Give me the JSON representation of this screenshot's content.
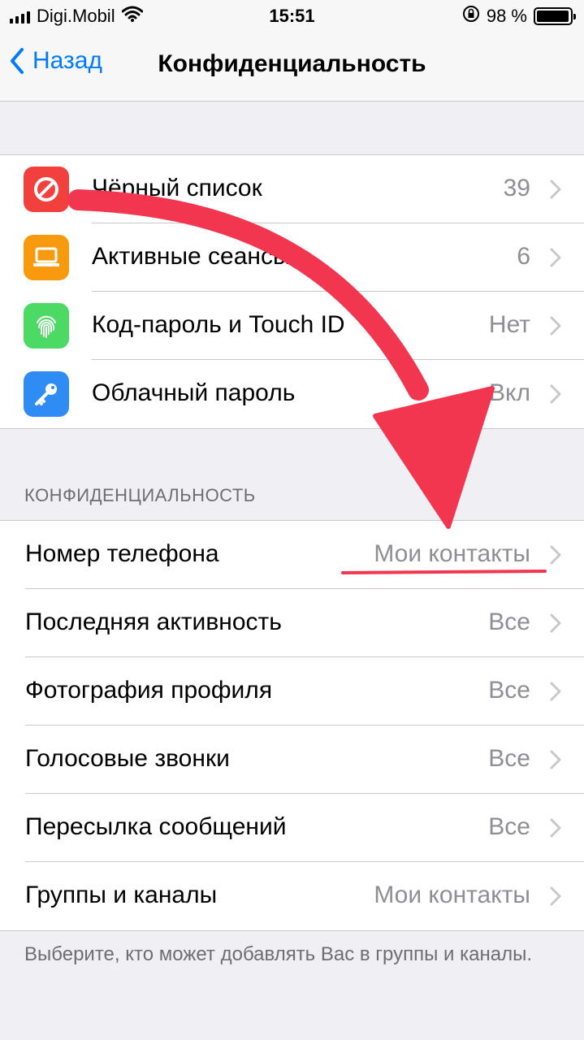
{
  "status_bar": {
    "carrier": "Digi.Mobil",
    "time": "15:51",
    "battery": "98 %",
    "battery_level": 0.98,
    "icons": [
      "signal-icon",
      "wifi-icon",
      "rotation-lock-icon",
      "battery-icon"
    ]
  },
  "nav": {
    "back_label": "Назад",
    "title": "Конфиденциальность"
  },
  "security": {
    "items": [
      {
        "label": "Чёрный список",
        "value": "39",
        "icon": "block-icon",
        "color": "#f2413c"
      },
      {
        "label": "Активные сеансы",
        "value": "6",
        "icon": "laptop-icon",
        "color": "#f79a0e"
      },
      {
        "label": "Код-пароль и Touch ID",
        "value": "Нет",
        "icon": "fingerprint-icon",
        "color": "#4cd964"
      },
      {
        "label": "Облачный пароль",
        "value": "Вкл",
        "icon": "key-icon",
        "color": "#2f8cf5"
      }
    ]
  },
  "privacy": {
    "header": "КОНФИДЕНЦИАЛЬНОСТЬ",
    "items": [
      {
        "label": "Номер телефона",
        "value": "Мои контакты"
      },
      {
        "label": "Последняя активность",
        "value": "Все"
      },
      {
        "label": "Фотография профиля",
        "value": "Все"
      },
      {
        "label": "Голосовые звонки",
        "value": "Все"
      },
      {
        "label": "Пересылка сообщений",
        "value": "Все"
      },
      {
        "label": "Группы и каналы",
        "value": "Мои контакты"
      }
    ],
    "footer": "Выберите, кто может добавлять Вас в группы и каналы."
  },
  "colors": {
    "accent": "#007aff",
    "annotation": "#f2364f"
  }
}
